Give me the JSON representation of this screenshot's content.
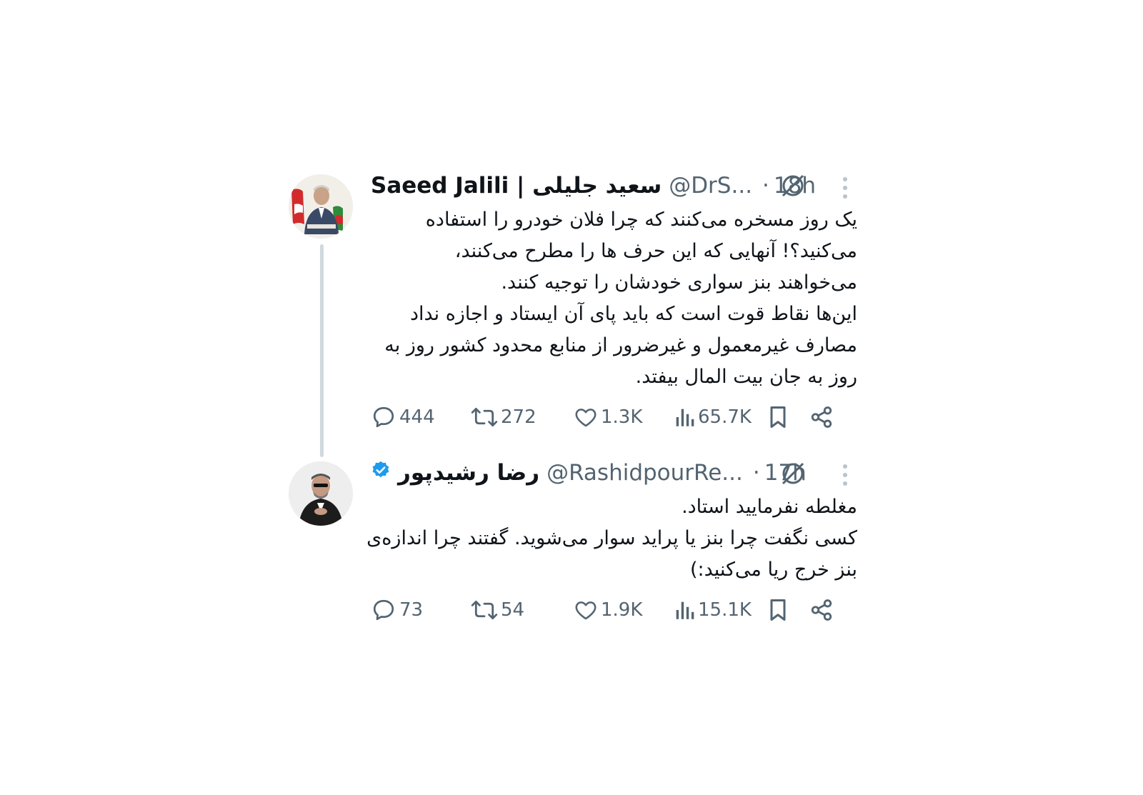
{
  "tweets": [
    {
      "name_latin": "Saeed Jalili",
      "name_separator": " | ",
      "name_persian": "سعید جلیلی",
      "handle": "@DrS...",
      "time": "18h",
      "text": "یک روز مسخره می‌کنند که چرا فلان خودرو را استفاده می‌کنید؟! آنهایی که این حرف ها را مطرح می‌کنند،\nمی‌خواهند بنز سواری خودشان را توجیه کنند.\nاین‌ها نقاط قوت است که باید پای آن ایستاد و اجازه نداد مصارف غیرمعمول و غیرضرور از منابع محدود کشور روز به روز به جان بیت المال بیفتد.",
      "replies": "444",
      "retweets": "272",
      "likes": "1.3K",
      "views": "65.7K"
    },
    {
      "name_persian": "رضا رشیدپور",
      "verified": true,
      "handle": "@RashidpourRe...",
      "time": "17h",
      "text": "مغلطه نفرمایید استاد.\nکسی نگفت چرا بنز یا پراید سوار می‌شوید. گفتند چرا اندازه‌ی بنز خرج ریا می‌کنید:)",
      "replies": "73",
      "retweets": "54",
      "likes": "1.9K",
      "views": "15.1K"
    }
  ],
  "colors": {
    "text": "#0f1419",
    "muted": "#536471",
    "verified": "#1d9bf0",
    "thread_line": "#cfd9de"
  },
  "icons": [
    "reply-icon",
    "retweet-icon",
    "like-icon",
    "views-icon",
    "bookmark-icon",
    "share-icon",
    "grok-icon",
    "more-icon",
    "verified-badge-icon"
  ]
}
